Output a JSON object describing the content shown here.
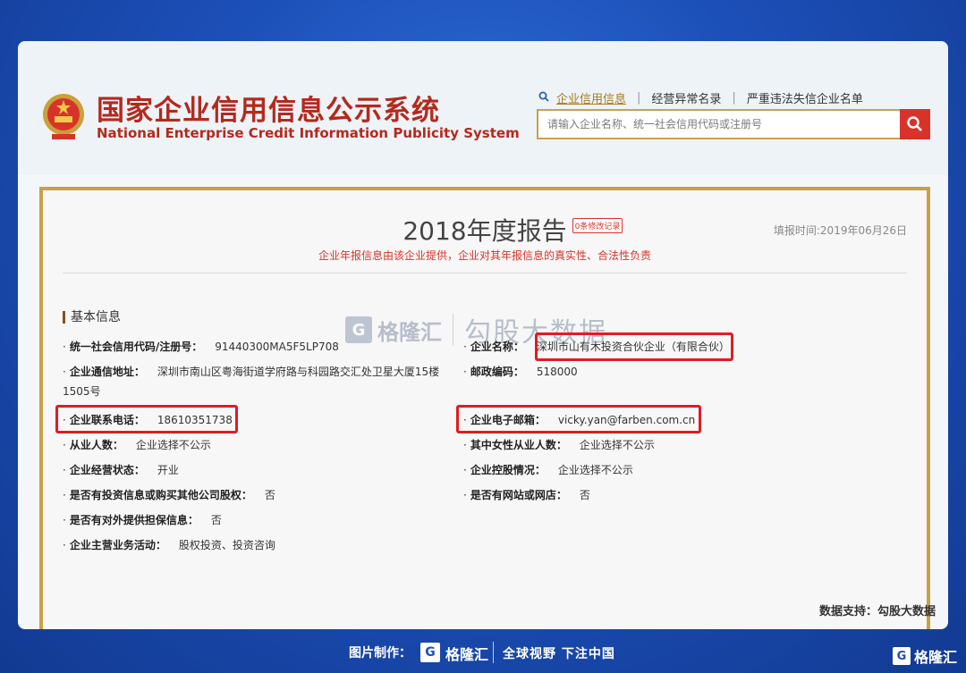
{
  "site": {
    "title_cn": "国家企业信用信息公示系统",
    "title_en": "National Enterprise Credit Information Publicity System",
    "nav": [
      "企业信用信息",
      "经营异常名录",
      "严重违法失信企业名单"
    ],
    "search_placeholder": "请输入企业名称、统一社会信用代码或注册号"
  },
  "report": {
    "title": "2018年度报告",
    "badge": "0条修改记录",
    "filing_date": "填报时间:2019年06月26日",
    "disclaimer": "企业年报信息由该企业提供，企业对其年报信息的真实性、合法性负责",
    "section": "基本信息",
    "left_fields": [
      {
        "label": "统一社会信用代码/注册号：",
        "value": "91440300MA5F5LP708"
      },
      {
        "label": "企业通信地址：",
        "value": "深圳市南山区粤海街道学府路与科园路交汇处卫星大厦15楼1505号"
      },
      {
        "label": "企业联系电话：",
        "value": "18610351738"
      },
      {
        "label": "从业人数：",
        "value": "企业选择不公示"
      },
      {
        "label": "企业经营状态：",
        "value": "开业"
      },
      {
        "label": "是否有投资信息或购买其他公司股权：",
        "value": "否"
      },
      {
        "label": "是否有对外提供担保信息：",
        "value": "否"
      },
      {
        "label": "企业主营业务活动：",
        "value": "股权投资、投资咨询"
      }
    ],
    "right_fields": [
      {
        "label": "企业名称：",
        "value": "深圳市山有木投资合伙企业（有限合伙）"
      },
      {
        "label": "邮政编码：",
        "value": "518000"
      },
      {
        "label": "企业电子邮箱：",
        "value": "vicky.yan@farben.com.cn"
      },
      {
        "label": "其中女性从业人数：",
        "value": "企业选择不公示"
      },
      {
        "label": "企业控股情况：",
        "value": "企业选择不公示"
      },
      {
        "label": "是否有网站或网店：",
        "value": "否"
      }
    ]
  },
  "watermark": {
    "brand": "格隆汇",
    "name": "勾股大数据"
  },
  "data_support": "数据支持：勾股大数据",
  "footer": {
    "made_by": "图片制作：",
    "brand": "格隆汇",
    "slogan": "全球视野 下注中国"
  },
  "colors": {
    "accent_red": "#d8332a",
    "gold": "#c8a04a",
    "background_blue": "#1c4fb8"
  },
  "icons": {
    "search": "search-icon",
    "emblem": "national-emblem-icon"
  }
}
